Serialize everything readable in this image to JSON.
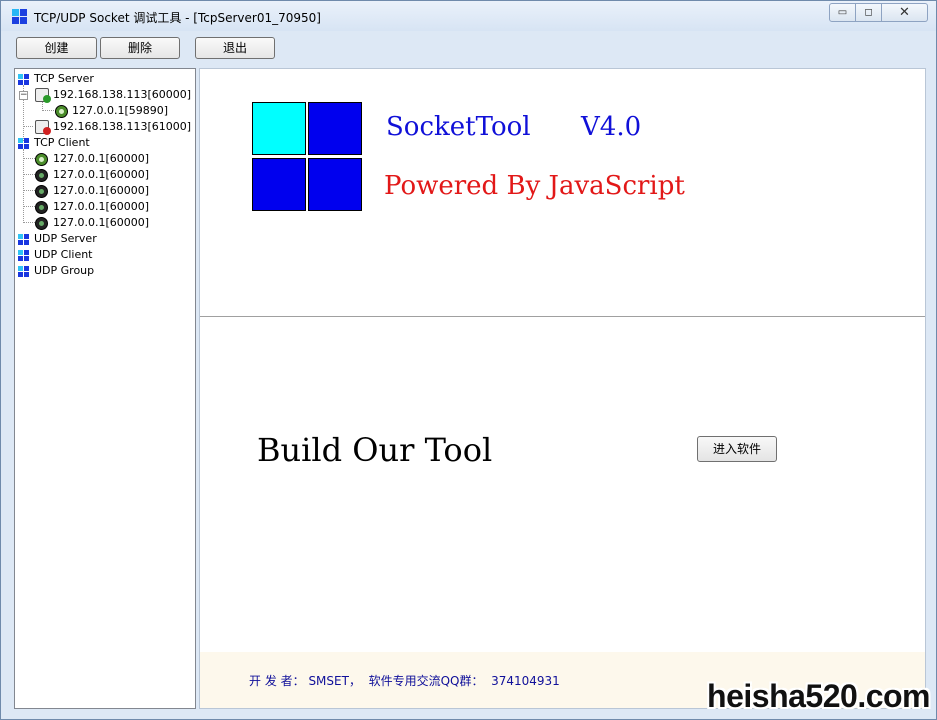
{
  "window": {
    "title": "TCP/UDP Socket 调试工具 - [TcpServer01_70950]",
    "minimize_glyph": "▭",
    "maximize_glyph": "◻",
    "close_glyph": "✕",
    "icon": "grid-app-icon"
  },
  "toolbar": {
    "create_label": "创建",
    "delete_label": "删除",
    "exit_label": "退出"
  },
  "tree": {
    "tcp_server": "TCP Server",
    "server1": "192.168.138.113[60000]",
    "server1_expander": "−",
    "server1_child": "127.0.0.1[59890]",
    "server2": "192.168.138.113[61000]",
    "tcp_client": "TCP Client",
    "clients": [
      "127.0.0.1[60000]",
      "127.0.0.1[60000]",
      "127.0.0.1[60000]",
      "127.0.0.1[60000]",
      "127.0.0.1[60000]"
    ],
    "udp_server": "UDP Server",
    "udp_client": "UDP Client",
    "udp_group": "UDP Group"
  },
  "about": {
    "product": "SocketTool",
    "version": "V4.0",
    "powered_by": "Powered By JavaScript",
    "slogan": "Build Our Tool",
    "enter_button": "进入软件",
    "footer": "开 发 者： SMSET，  软件专用交流QQ群：  374104931"
  },
  "watermark": "heisha520.com",
  "colors": {
    "logo_cyan": "#00ffff",
    "logo_blue": "#0000ee",
    "product_text": "#1010d8",
    "powered_text": "#e21818",
    "footer_bg": "#fdf8ec"
  }
}
